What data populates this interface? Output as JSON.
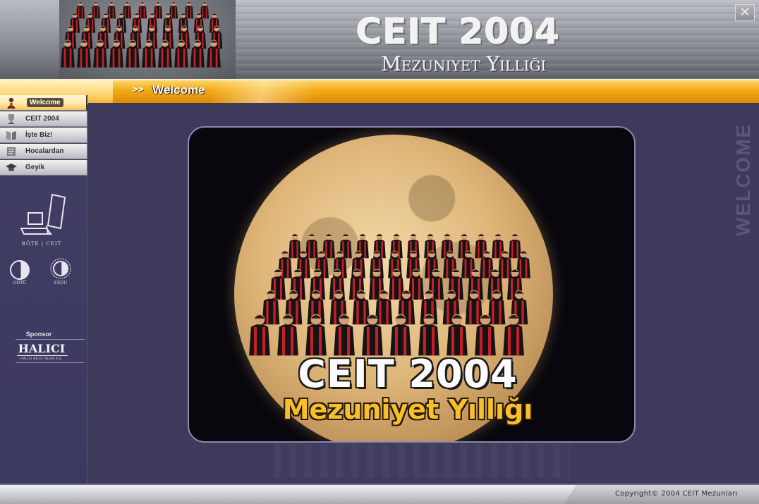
{
  "header": {
    "title": "CEIT 2004",
    "subtitle": "Mezuniyet Yıllığı",
    "close_glyph": "✕"
  },
  "breadcrumb": {
    "arrows": ">>",
    "title": "Welcome"
  },
  "sidebar": {
    "items": [
      {
        "label": "Welcome",
        "icon": "person-icon",
        "active": true
      },
      {
        "label": "CEIT 2004",
        "icon": "trophy-icon",
        "active": false
      },
      {
        "label": "İşte Biz!",
        "icon": "book-icon",
        "active": false
      },
      {
        "label": "Hocalardan",
        "icon": "notebook-icon",
        "active": false
      },
      {
        "label": "Geyik",
        "icon": "graduation-cap-icon",
        "active": false
      }
    ],
    "bote_label": "BÖTE | CEIT",
    "odtu_label": "ODTÜ",
    "fedu_label": "FEDU",
    "sponsor_label": "Sponsor",
    "sponsor_name": "HALICI",
    "sponsor_sub": "HALICI BİLGİ İŞLEM A.Ş."
  },
  "main": {
    "side_label": "WELCOME",
    "photo_title": "CEIT 2004",
    "photo_subtitle": "Mezuniyet Yıllığı"
  },
  "footer": {
    "copyright": "Copyright©  2004 CEIT Mezunları"
  },
  "colors": {
    "accent_orange": "#f3a915",
    "background": "#3d3a5c",
    "gown_red": "#c81e2a",
    "gown_black": "#141414"
  }
}
